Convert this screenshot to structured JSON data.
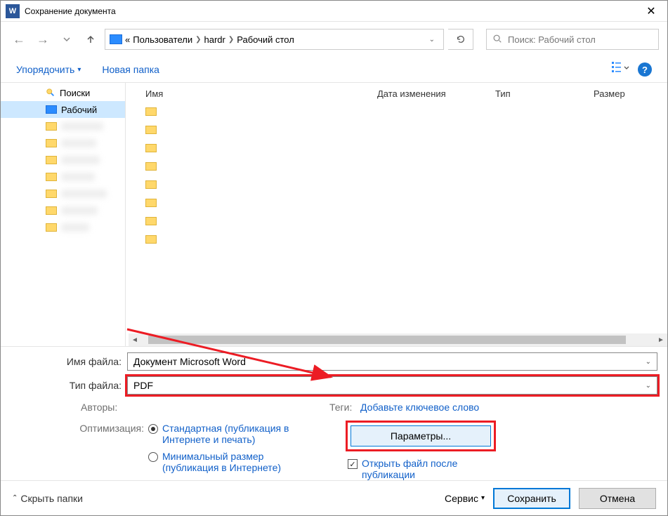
{
  "window": {
    "title": "Сохранение документа"
  },
  "address": {
    "root_label": "«",
    "seg1": "Пользователи",
    "seg2": "hardr",
    "seg3": "Рабочий стол"
  },
  "search": {
    "placeholder": "Поиск: Рабочий стол"
  },
  "toolbar": {
    "organize": "Упорядочить",
    "new_folder": "Новая папка"
  },
  "tree": {
    "searches": "Поиски",
    "desktop": "Рабочий"
  },
  "columns": {
    "name": "Имя",
    "date": "Дата изменения",
    "type": "Тип",
    "size": "Размер"
  },
  "fields": {
    "filename_label": "Имя файла:",
    "filename_value": "Документ Microsoft Word",
    "filetype_label": "Тип файла:",
    "filetype_value": "PDF",
    "authors_label": "Авторы:",
    "tags_label": "Теги:",
    "tags_link": "Добавьте ключевое слово"
  },
  "optimize": {
    "label": "Оптимизация:",
    "standard": "Стандартная (публикация в Интернете и печать)",
    "minimal": "Минимальный размер (публикация в Интернете)",
    "params_btn": "Параметры...",
    "open_after": "Открыть файл после публикации"
  },
  "footer": {
    "hide_folders": "Скрыть папки",
    "service": "Сервис",
    "save": "Сохранить",
    "cancel": "Отмена"
  }
}
